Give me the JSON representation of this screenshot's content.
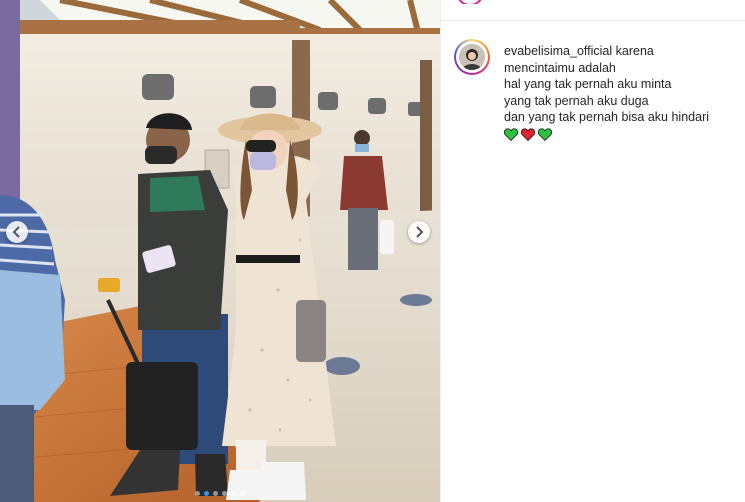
{
  "post": {
    "username": "evabelisima_official",
    "caption_lines": [
      "karena",
      "mencintaimu adalah",
      "hal yang tak pernah aku minta",
      "yang tak pernah aku duga",
      "dan yang tak pernah bisa aku hindari"
    ],
    "emoji": [
      {
        "icon": "green-heart-icon",
        "color": "#2ec040"
      },
      {
        "icon": "red-heart-icon",
        "color": "#e0202b"
      },
      {
        "icon": "green-heart-icon",
        "color": "#2ec040"
      }
    ]
  },
  "carousel": {
    "slide_count": 6,
    "active_slide": 2
  },
  "colors": {
    "accent": "#2f95f0",
    "text": "#262626",
    "divider": "#efefef"
  }
}
